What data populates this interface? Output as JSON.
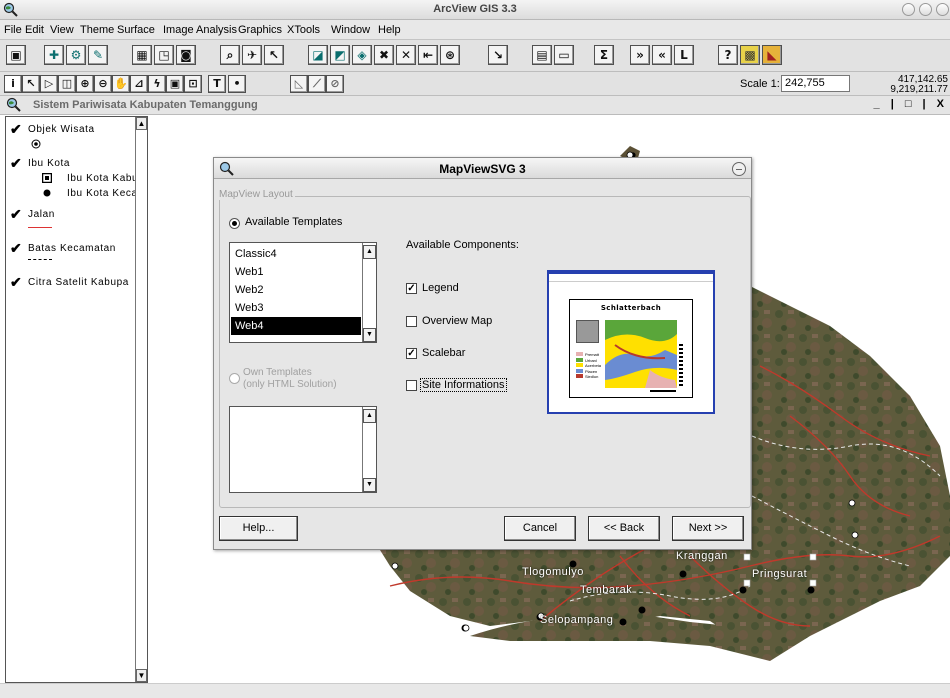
{
  "app": {
    "title": "ArcView GIS 3.3"
  },
  "menu": [
    "File",
    "Edit",
    "View",
    "Theme",
    "Surface",
    "Image Analysis",
    "Graphics",
    "XTools",
    "Window",
    "Help"
  ],
  "scale": {
    "label": "Scale 1:",
    "value": "242,755"
  },
  "coords": {
    "x": "417,142.65",
    "y": "9,219,211.77"
  },
  "view": {
    "title": "Sistem Pariwisata Kabupaten Temanggung",
    "window_controls": "_ | □ | X"
  },
  "toc": {
    "layers": [
      {
        "name": "Objek Wisata",
        "checked": true
      },
      {
        "name": "Ibu Kota",
        "checked": true,
        "legend": [
          "Ibu Kota Kabu",
          "Ibu Kota Keca"
        ]
      },
      {
        "name": "Jalan",
        "checked": true
      },
      {
        "name": "Batas Kecamatan",
        "checked": true
      },
      {
        "name": "Citra Satelit Kabupa",
        "checked": true
      }
    ]
  },
  "map": {
    "labels": [
      "Kranggan",
      "Pringsurat",
      "Tlogomulyo",
      "Tembarak",
      "Selopampang"
    ]
  },
  "dialog": {
    "title": "MapViewSVG 3",
    "group_label": "MapView Layout",
    "available_templates_label": "Available Templates",
    "templates": [
      "Classic4",
      "Web1",
      "Web2",
      "Web3",
      "Web4"
    ],
    "selected_template": "Web4",
    "own_templates_label_1": "Own Templates",
    "own_templates_label_2": "(only HTML Solution)",
    "components_label": "Available Components:",
    "components": [
      {
        "label": "Legend",
        "checked": true
      },
      {
        "label": "Overview Map",
        "checked": false
      },
      {
        "label": "Scalebar",
        "checked": true
      },
      {
        "label": "Site Informations",
        "checked": false
      }
    ],
    "preview_title": "Schlatterbach",
    "preview_legend": [
      "Prematt",
      "Urbanl",
      "Acerbeta",
      "Placen",
      "Siedlun"
    ],
    "buttons": {
      "help": "Help...",
      "cancel": "Cancel",
      "back": "<< Back",
      "next": "Next >>"
    }
  }
}
